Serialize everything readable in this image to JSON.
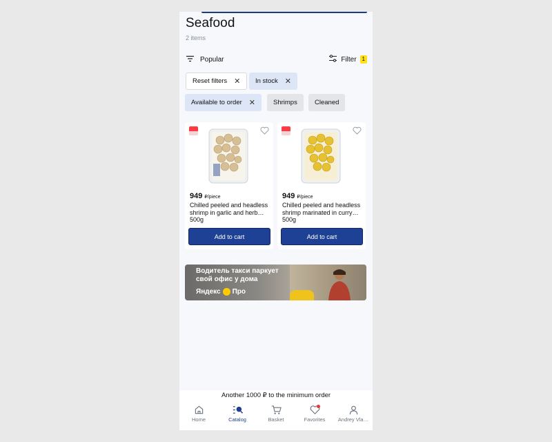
{
  "page": {
    "title": "Seafood",
    "items_count": "2 items"
  },
  "sort": {
    "label": "Popular",
    "icon": "sort-lines-icon"
  },
  "filter": {
    "label": "Filter",
    "badge": "1",
    "icon": "sliders-icon",
    "badge_color": "#ffe01b"
  },
  "chips": {
    "reset": "Reset filters",
    "in_stock": "In stock",
    "available": "Available to order",
    "shrimps": "Shrimps",
    "cleaned": "Cleaned"
  },
  "products": [
    {
      "price": "949",
      "unit": "₽/piece",
      "name": "Chilled peeled and headless shrimp in garlic and herb…",
      "weight": "500g",
      "button": "Add to cart"
    },
    {
      "price": "949",
      "unit": "₽/piece",
      "name": "Chilled peeled and headless shrimp marinated in curry…",
      "weight": "500g",
      "button": "Add to cart"
    }
  ],
  "banner": {
    "headline": "Водитель такси паркует свой офис у дома",
    "brand": "Яндекс",
    "brand_suffix": "Про"
  },
  "footer": {
    "min_order": "Another 1000 ₽ to the minimum order"
  },
  "tabs": [
    {
      "label": "Home",
      "icon": "home-icon"
    },
    {
      "label": "Catalog",
      "icon": "catalog-search-icon"
    },
    {
      "label": "Basket",
      "icon": "cart-icon"
    },
    {
      "label": "Favorites",
      "icon": "heart-icon"
    },
    {
      "label": "Andrey Vla…",
      "icon": "user-icon"
    }
  ],
  "colors": {
    "accent": "#1e4196",
    "chip_active": "#dde6f7",
    "notification": "#e53935"
  }
}
